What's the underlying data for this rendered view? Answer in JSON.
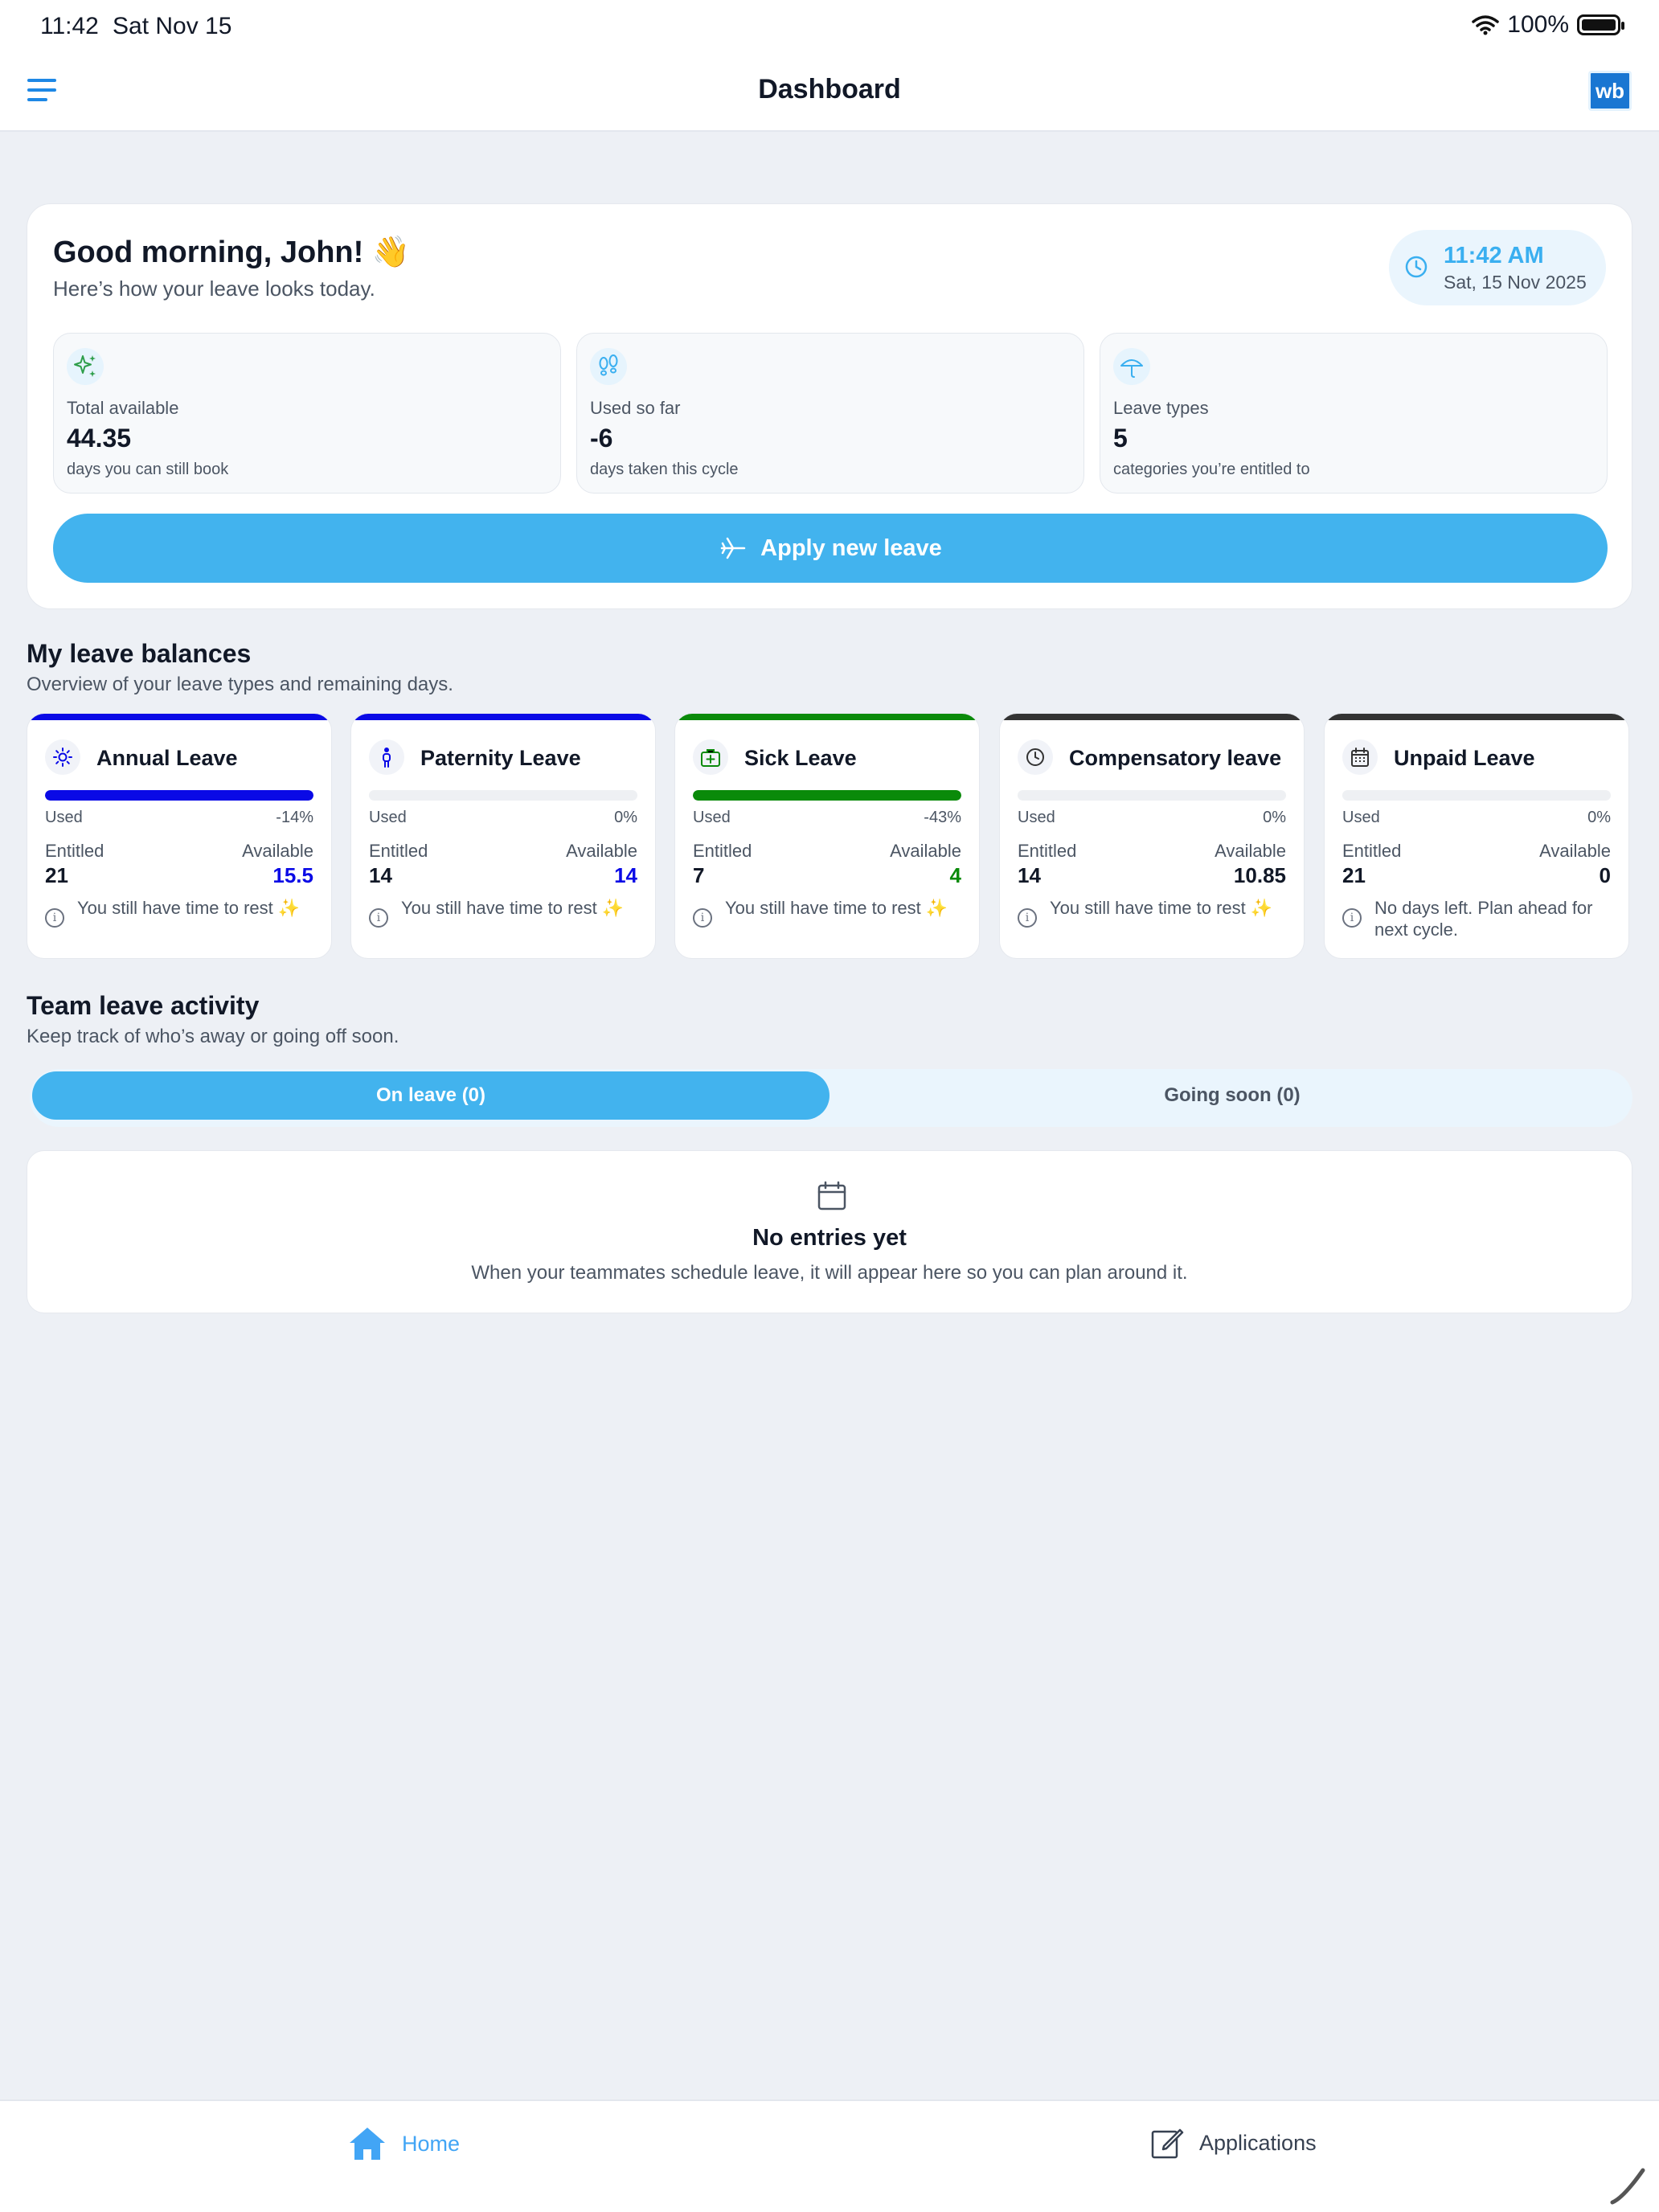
{
  "status_bar": {
    "time": "11:42",
    "date": "Sat Nov 15",
    "battery": "100%"
  },
  "header": {
    "title": "Dashboard",
    "logo_text": "wb"
  },
  "hero": {
    "greeting": "Good morning, John! 👋",
    "subtitle": "Here’s how your leave looks today.",
    "clock_time": "11:42 AM",
    "clock_date": "Sat, 15 Nov 2025",
    "stats": [
      {
        "label": "Total available",
        "value": "44.35",
        "hint": "days you can still book",
        "icon": "sparkles-icon"
      },
      {
        "label": "Used so far",
        "value": "-6",
        "hint": "days taken this cycle",
        "icon": "footprints-icon"
      },
      {
        "label": "Leave types",
        "value": "5",
        "hint": "categories you’re entitled to",
        "icon": "umbrella-icon"
      }
    ],
    "apply_label": "Apply new leave"
  },
  "balances": {
    "title": "My leave balances",
    "subtitle": "Overview of your leave types and remaining days.",
    "used_label": "Used",
    "entitled_label": "Entitled",
    "available_label": "Available",
    "cards": [
      {
        "name": "Annual Leave",
        "icon": "sun-icon",
        "color": "#0a0ae6",
        "used_pct": "-14%",
        "used_fill": 1.0,
        "entitled": "21",
        "available": "15.5",
        "message": "You still have time to rest ✨"
      },
      {
        "name": "Paternity Leave",
        "icon": "person-icon",
        "color": "#0a0ae6",
        "used_pct": "0%",
        "used_fill": 0.0,
        "entitled": "14",
        "available": "14",
        "message": "You still have time to rest ✨"
      },
      {
        "name": "Sick Leave",
        "icon": "medical-kit-icon",
        "color": "#0a8a0a",
        "used_pct": "-43%",
        "used_fill": 1.0,
        "entitled": "7",
        "available": "4",
        "message": "You still have time to rest ✨"
      },
      {
        "name": "Compensatory leave",
        "icon": "clock-icon",
        "color": "#333333",
        "used_pct": "0%",
        "used_fill": 0.0,
        "entitled": "14",
        "available": "10.85",
        "message": "You still have time to rest ✨"
      },
      {
        "name": "Unpaid Leave",
        "icon": "calendar-icon",
        "color": "#333333",
        "used_pct": "0%",
        "used_fill": 0.0,
        "entitled": "21",
        "available": "0",
        "message": "No days left. Plan ahead for next cycle."
      }
    ]
  },
  "team": {
    "title": "Team leave activity",
    "subtitle": "Keep track of who’s away or going off soon.",
    "tab_on_leave": "On leave (0)",
    "tab_going_soon": "Going soon (0)",
    "empty_title": "No entries yet",
    "empty_desc": "When your teammates schedule leave, it will appear here so you can plan around it."
  },
  "bottom_nav": {
    "home": "Home",
    "applications": "Applications"
  },
  "colors": {
    "accent": "#42b3ee",
    "primary_blue": "#0a0ae6",
    "green": "#0a8a0a"
  }
}
